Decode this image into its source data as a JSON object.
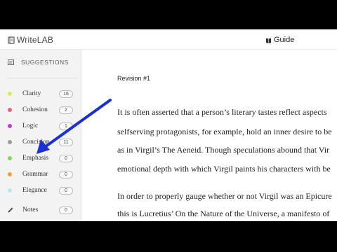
{
  "app": {
    "logo_write": "Write",
    "logo_lab": "LAB",
    "guide_label": "Guide"
  },
  "sidebar": {
    "header": "SUGGESTIONS",
    "items": [
      {
        "label": "Clarity",
        "count": "16",
        "color": "#e6e84a"
      },
      {
        "label": "Cohesion",
        "count": "2",
        "color": "#e8607a"
      },
      {
        "label": "Logic",
        "count": "1",
        "color": "#c23ed0"
      },
      {
        "label": "Concision",
        "count": "11",
        "color": "#9a9a9a"
      },
      {
        "label": "Emphasis",
        "count": "0",
        "color": "#7ed957"
      },
      {
        "label": "Grammar",
        "count": "0",
        "color": "#f0a030"
      },
      {
        "label": "Elegance",
        "count": "0",
        "color": "#a8f0e8"
      }
    ],
    "notes": {
      "label": "Notes",
      "count": "0"
    }
  },
  "document": {
    "revision": "Revision #1",
    "lines": [
      "It is often asserted that a person’s literary tastes reflect aspects",
      "selfserving protagonists, for example, hold an inner desire to be",
      "as in Virgil’s The Aeneid. Though speculations abound that Vir",
      "emotional depth with which Virgil paints his characters with be",
      "In order to properly gauge whether or not Virgil was an Epicure",
      "this is Lucretius’ On the Nature of the Universe, a manifesto of"
    ]
  },
  "colors": {
    "arrow": "#1a2fd6"
  }
}
